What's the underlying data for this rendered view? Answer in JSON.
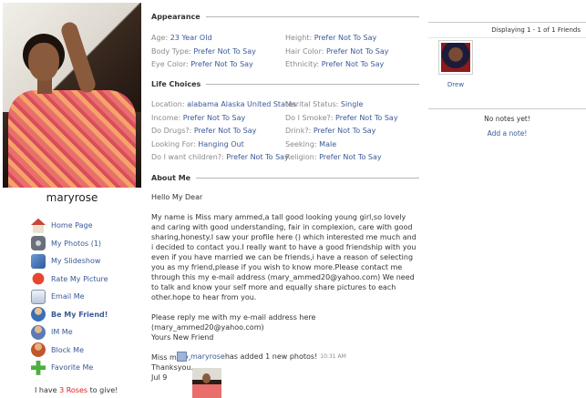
{
  "profile": {
    "username": "maryrose",
    "roses_prefix": "I have ",
    "roses_count": "3 Roses",
    "roses_suffix": " to give!"
  },
  "actions": [
    {
      "label": "Home Page",
      "icon": "home-icon"
    },
    {
      "label": "My Photos (1)",
      "icon": "photos-icon"
    },
    {
      "label": "My Slideshow",
      "icon": "slideshow-icon"
    },
    {
      "label": "Rate My Picture",
      "icon": "heart-icon"
    },
    {
      "label": "Email Me",
      "icon": "email-icon"
    },
    {
      "label": "Be My Friend!",
      "icon": "add-friend-icon"
    },
    {
      "label": "IM Me",
      "icon": "im-icon"
    },
    {
      "label": "Block Me",
      "icon": "block-icon"
    },
    {
      "label": "Favorite Me",
      "icon": "favorite-icon"
    }
  ],
  "appearance": {
    "title": "Appearance",
    "rows": [
      [
        {
          "label": "Age:",
          "value": "23 Year Old"
        },
        {
          "label": "Height:",
          "value": "Prefer Not To Say"
        }
      ],
      [
        {
          "label": "Body Type:",
          "value": "Prefer Not To Say"
        },
        {
          "label": "Hair Color:",
          "value": "Prefer Not To Say"
        }
      ],
      [
        {
          "label": "Eye Color:",
          "value": "Prefer Not To Say"
        },
        {
          "label": "Ethnicity:",
          "value": "Prefer Not To Say"
        }
      ]
    ]
  },
  "life_choices": {
    "title": "Life Choices",
    "rows": [
      [
        {
          "label": "Location:",
          "value": "alabama Alaska United States"
        },
        {
          "label": "Marital Status:",
          "value": "Single"
        }
      ],
      [
        {
          "label": "Income:",
          "value": "Prefer Not To Say"
        },
        {
          "label": "Do I Smoke?:",
          "value": "Prefer Not To Say"
        }
      ],
      [
        {
          "label": "Do Drugs?:",
          "value": "Prefer Not To Say"
        },
        {
          "label": "Drink?:",
          "value": "Prefer Not To Say"
        }
      ],
      [
        {
          "label": "Looking For:",
          "value": "Hanging Out"
        },
        {
          "label": "Seeking:",
          "value": "Male"
        }
      ],
      [
        {
          "label": "Do I want children?:",
          "value": "Prefer Not To Say"
        },
        {
          "label": "Religion:",
          "value": "Prefer Not To Say"
        }
      ]
    ]
  },
  "about": {
    "title": "About Me",
    "paragraphs": [
      "Hello My Dear",
      "My name is Miss mary ammed,a tall good looking young girl,so lovely and caring with good understanding, fair in complexion, care with good sharing,honesty.I saw your profile here () which interested me much and i decided to contact you.I really want to have a good friendship with you even if you have married we can be friends,i have a reason of selecting you as my friend,please if you wish to know more.Please contact me through this my e-mail address (mary_ammed20@yahoo.com) We need to talk and know your self more and equally share pictures to each other.hope to hear from you.",
      "Please reply me with my e-mail address here (mary_ammed20@yahoo.com)\nYours New Friend",
      "Miss mary,\nThanksyou.\nJul 9"
    ]
  },
  "feed": {
    "user": "maryrose",
    "text": " has added 1 new photos! ",
    "time": "10:31 AM"
  },
  "friends": {
    "count_text": "Displaying 1 - 1 of 1 Friends",
    "items": [
      {
        "name": "Drew"
      }
    ]
  },
  "notes": {
    "empty_text": "No notes yet!",
    "add_label": "Add a note!"
  }
}
